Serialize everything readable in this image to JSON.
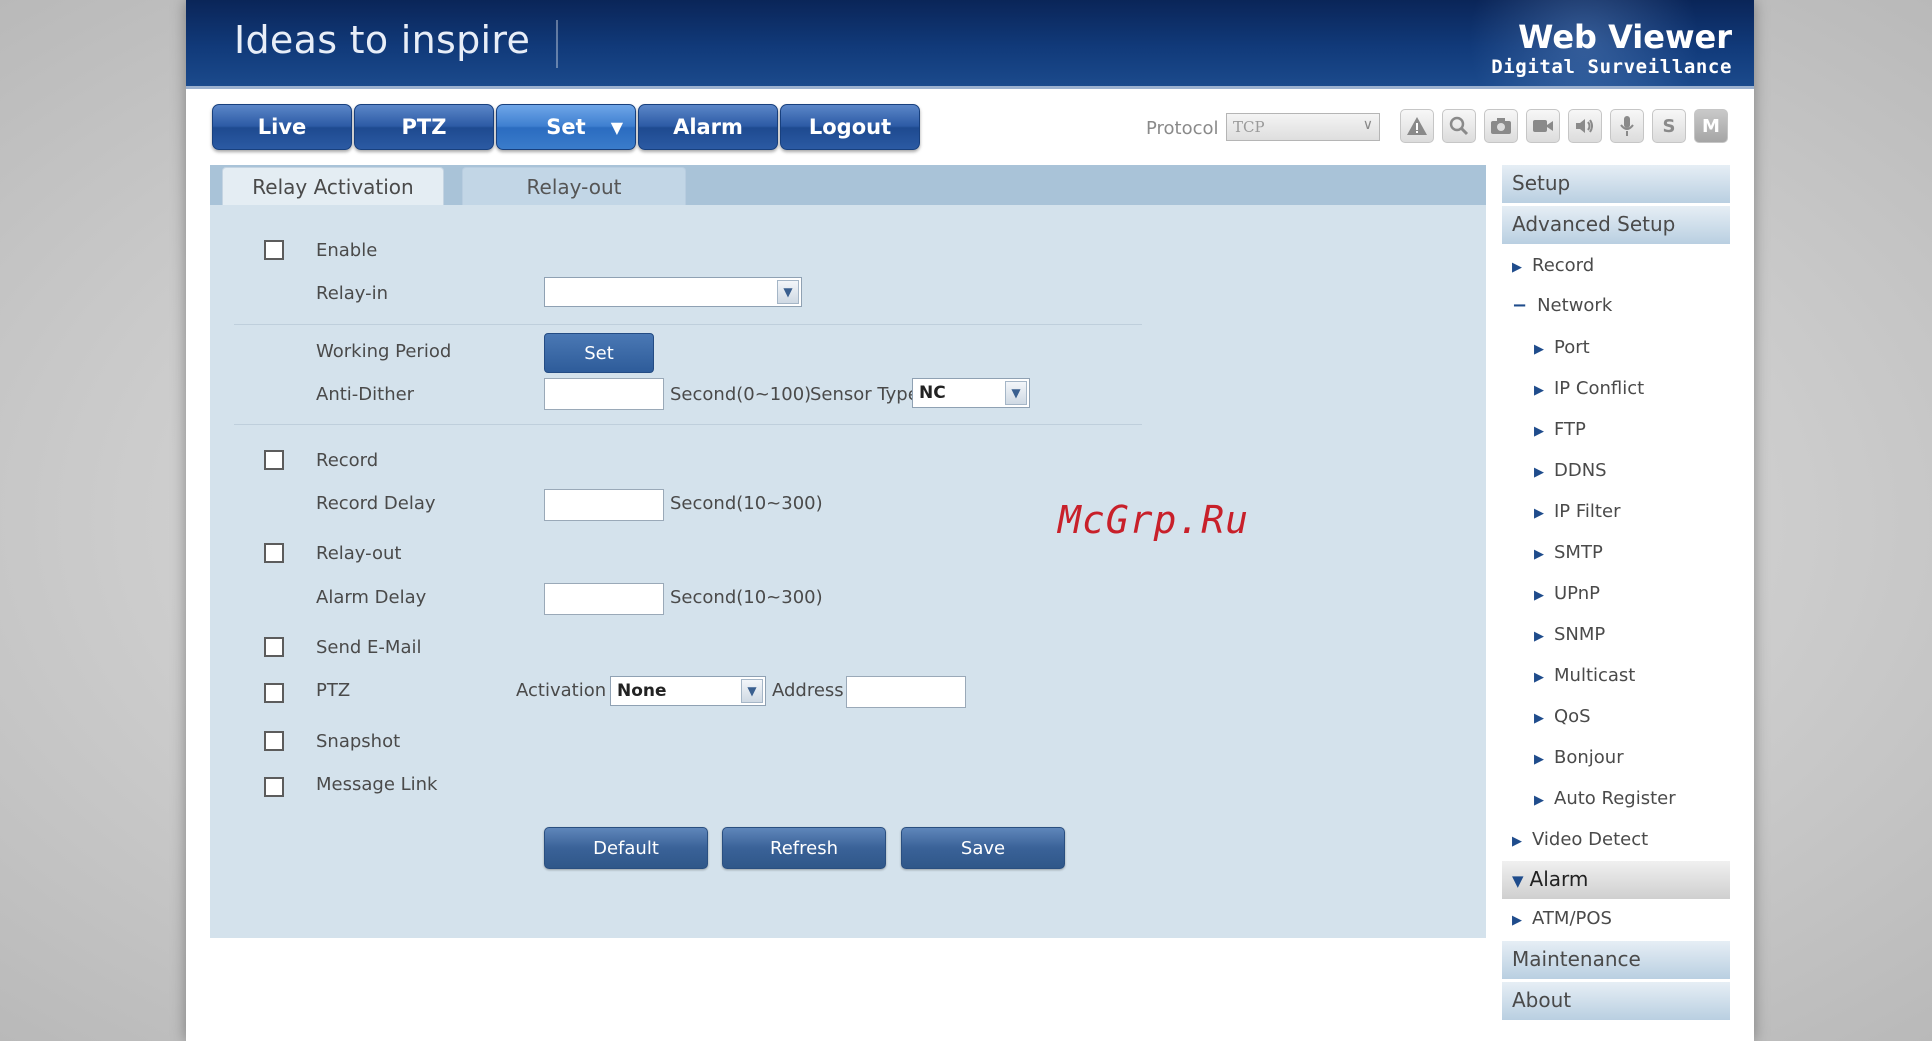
{
  "header": {
    "slogan": "Ideas to inspire",
    "brand_title": "Web Viewer",
    "brand_subtitle": "Digital Surveillance"
  },
  "nav": {
    "live": "Live",
    "ptz": "PTZ",
    "set": "Set",
    "set_caret": "▼",
    "alarm": "Alarm",
    "logout": "Logout"
  },
  "toolbar": {
    "protocol_label": "Protocol",
    "protocol_value": "TCP",
    "icons": [
      "alert-icon",
      "zoom-icon",
      "snapshot-icon",
      "record-icon",
      "audio-icon",
      "microphone-icon",
      "s-icon",
      "m-icon"
    ],
    "s_label": "S",
    "m_label": "M"
  },
  "tabs": {
    "relay_activation": "Relay Activation",
    "relay_out": "Relay-out"
  },
  "form": {
    "enable": "Enable",
    "relay_in": "Relay-in",
    "relay_in_value": "",
    "working_period": "Working Period",
    "set_button": "Set",
    "anti_dither": "Anti-Dither",
    "anti_dither_value": "",
    "anti_dither_unit": "Second(0~100)",
    "sensor_type": "Sensor Type",
    "sensor_type_value": "NC",
    "record": "Record",
    "record_delay": "Record Delay",
    "record_delay_value": "",
    "record_delay_unit": "Second(10~300)",
    "relay_out": "Relay-out",
    "alarm_delay": "Alarm Delay",
    "alarm_delay_value": "",
    "alarm_delay_unit": "Second(10~300)",
    "send_email": "Send E-Mail",
    "ptz": "PTZ",
    "activation": "Activation",
    "activation_value": "None",
    "address": "Address",
    "address_value": "",
    "snapshot": "Snapshot",
    "message_link": "Message Link"
  },
  "actions": {
    "default": "Default",
    "refresh": "Refresh",
    "save": "Save"
  },
  "watermark": "McGrp.Ru",
  "sidebar": {
    "setup": "Setup",
    "advanced_setup": "Advanced Setup",
    "record": "Record",
    "network": "Network",
    "network_items": [
      "Port",
      "IP Conflict",
      "FTP",
      "DDNS",
      "IP Filter",
      "SMTP",
      "UPnP",
      "SNMP",
      "Multicast",
      "QoS",
      "Bonjour",
      "Auto Register"
    ],
    "video_detect": "Video Detect",
    "alarm": "Alarm",
    "atm_pos": "ATM/POS",
    "maintenance": "Maintenance",
    "about": "About"
  },
  "colors": {
    "header_bg": "#113a7a",
    "nav_button": "#2c5ba5",
    "nav_button_active": "#3e7fd0",
    "panel_bg": "#d4e2ec",
    "tabbar_bg": "#a9c3d8",
    "watermark": "#c8202a"
  }
}
